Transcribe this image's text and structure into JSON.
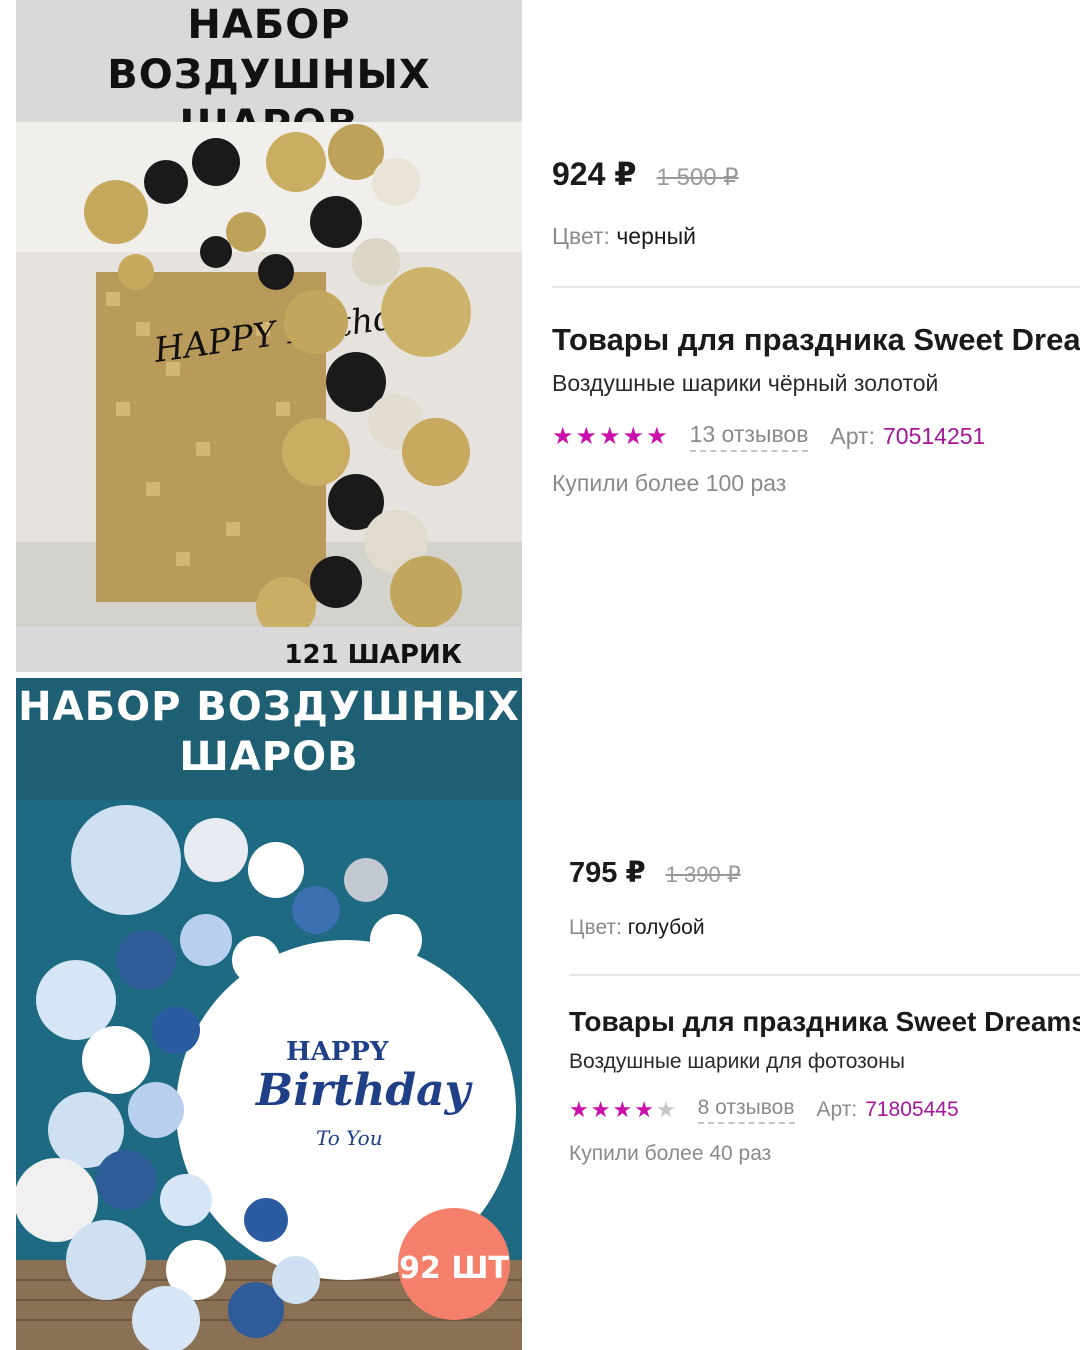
{
  "products": [
    {
      "image_title_line1": "НАБОР",
      "image_title_line2": "ВОЗДУШНЫХ ШАРОВ",
      "image_badge": "121 ШАРИК",
      "image_sign": "HAPPY Birthday",
      "price": "924 ₽",
      "old_price": "1 500 ₽",
      "color_label": "Цвет:",
      "color_value": "черный",
      "brand": "Товары для праздника Sweet Dreams",
      "subtitle": "Воздушные шарики чёрный золотой",
      "rating": 5,
      "reviews": "13 отзывов",
      "art_label": "Арт:",
      "art_value": "70514251",
      "bought": "Купили более 100 раз"
    },
    {
      "image_title_line1": "НАБОР ВОЗДУШНЫХ",
      "image_title_line2": "ШАРОВ",
      "image_badge": "92 ШТ",
      "image_sign_line1": "HAPPY",
      "image_sign_line2": "Birthday",
      "image_sign_line3": "To You",
      "price": "795 ₽",
      "old_price": "1 390 ₽",
      "color_label": "Цвет:",
      "color_value": "голубой",
      "brand": "Товары для праздника Sweet Dreams",
      "subtitle": "Воздушные шарики для фотозоны",
      "rating": 4,
      "reviews": "8 отзывов",
      "art_label": "Арт:",
      "art_value": "71805445",
      "bought": "Купили более 40 раз"
    }
  ],
  "colors": {
    "accent_star": "#cb11ab",
    "article": "#a5169a",
    "muted": "#8a8a8a"
  }
}
